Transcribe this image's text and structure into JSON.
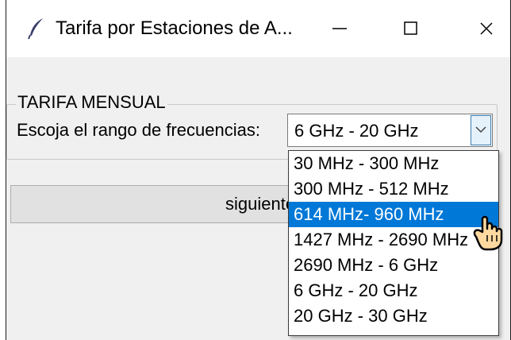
{
  "window": {
    "title": "Tarifa por Estaciones de A...",
    "icon": "feather-icon",
    "controls": [
      "minimize-icon",
      "maximize-icon",
      "close-icon"
    ]
  },
  "group": {
    "label": "TARIFA MENSUAL"
  },
  "form": {
    "frequency_label": "Escoja el rango de frecuencias:",
    "combo_value": "6 GHz - 20 GHz",
    "next_label": "siguiente"
  },
  "dropdown": {
    "items": [
      "30 MHz - 300 MHz",
      "300 MHz - 512 MHz",
      "614 MHz- 960 MHz",
      "1427 MHz - 2690 MHz",
      "2690 MHz - 6 GHz",
      "6 GHz - 20 GHz",
      "20 GHz - 30 GHz"
    ],
    "highlighted_index": 2
  },
  "colors": {
    "highlight": "#0078d7",
    "window_bg": "#f0f0f0",
    "cursor_fill": "#ffd9a0"
  }
}
